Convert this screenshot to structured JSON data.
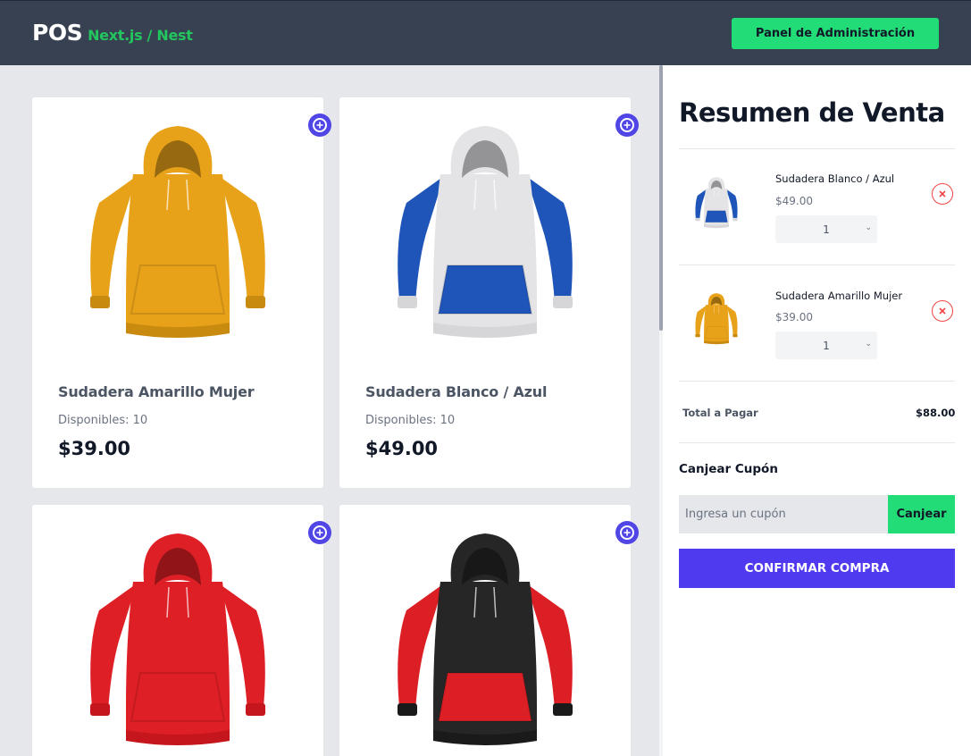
{
  "app": {
    "logo_main": "POS",
    "logo_sub": "Next.js / Nest",
    "admin_button": "Panel de Administración"
  },
  "products": [
    {
      "name": "Sudadera Amarillo Mujer",
      "stock": "Disponibles: 10",
      "price": "$39.00",
      "colors": {
        "body": "#e8a21a",
        "sleeve": "#e8a21a",
        "pocket": "#e8a21a",
        "trim": "#c98a10"
      }
    },
    {
      "name": "Sudadera Blanco / Azul",
      "stock": "Disponibles: 10",
      "price": "$49.00",
      "colors": {
        "body": "#e4e4e6",
        "sleeve": "#1f55b8",
        "pocket": "#1f55b8",
        "trim": "#d6d6d8"
      }
    },
    {
      "name": "",
      "stock": "",
      "price": "",
      "colors": {
        "body": "#de1f25",
        "sleeve": "#de1f25",
        "pocket": "#de1f25",
        "trim": "#c4161c"
      }
    },
    {
      "name": "",
      "stock": "",
      "price": "",
      "colors": {
        "body": "#262626",
        "sleeve": "#dc1f24",
        "pocket": "#dc1f24",
        "trim": "#1a1a1a"
      }
    }
  ],
  "sidebar": {
    "title": "Resumen de Venta",
    "items": [
      {
        "name": "Sudadera Blanco / Azul",
        "price": "$49.00",
        "qty": "1"
      },
      {
        "name": "Sudadera Amarillo Mujer",
        "price": "$39.00",
        "qty": "1"
      }
    ],
    "total_label": "Total a Pagar",
    "total_value": "$88.00",
    "coupon_title": "Canjear Cupón",
    "coupon_placeholder": "Ingresa un cupón",
    "coupon_button": "Canjear",
    "confirm_button": "CONFIRMAR COMPRA"
  },
  "theme": {
    "accent": "#4f46e5",
    "success": "#22dd77",
    "header_bg": "#374151",
    "danger": "#ef4444"
  }
}
